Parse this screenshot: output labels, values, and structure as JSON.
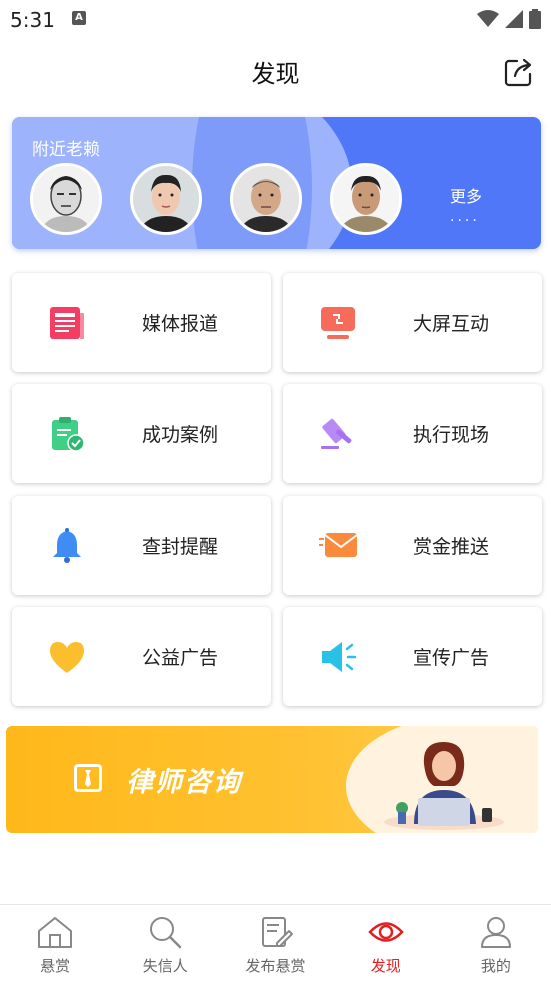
{
  "status_bar": {
    "time": "5:31",
    "notification_letter": "A"
  },
  "header": {
    "title": "发现"
  },
  "nearby": {
    "title": "附近老赖",
    "more_label": "更多",
    "more_dots": "····",
    "avatars": [
      "person-1",
      "person-2",
      "person-3",
      "person-4"
    ]
  },
  "tiles": [
    {
      "label": "媒体报道",
      "icon": "newspaper-icon",
      "color": "#f43d63"
    },
    {
      "label": "大屏互动",
      "icon": "screen-interact-icon",
      "color": "#f76b5b"
    },
    {
      "label": "成功案例",
      "icon": "clipboard-check-icon",
      "color": "#3fcf86"
    },
    {
      "label": "执行现场",
      "icon": "gavel-icon",
      "color": "#a771f0"
    },
    {
      "label": "查封提醒",
      "icon": "bell-icon",
      "color": "#3f8cf5"
    },
    {
      "label": "赏金推送",
      "icon": "envelope-icon",
      "color": "#fb8b3c"
    },
    {
      "label": "公益广告",
      "icon": "heart-icon",
      "color": "#fbbe2d"
    },
    {
      "label": "宣传广告",
      "icon": "megaphone-icon",
      "color": "#27c2e5"
    }
  ],
  "lawyer_banner": {
    "title": "律师咨询"
  },
  "bottom_nav": {
    "items": [
      {
        "label": "悬赏",
        "icon": "home-icon"
      },
      {
        "label": "失信人",
        "icon": "search-icon"
      },
      {
        "label": "发布悬赏",
        "icon": "edit-icon"
      },
      {
        "label": "发现",
        "icon": "eye-icon",
        "active": true
      },
      {
        "label": "我的",
        "icon": "user-icon"
      }
    ]
  },
  "colors": {
    "accent": "#e02020",
    "banner_blue": "#4f77f8",
    "banner_yellow": "#ffb81a"
  }
}
